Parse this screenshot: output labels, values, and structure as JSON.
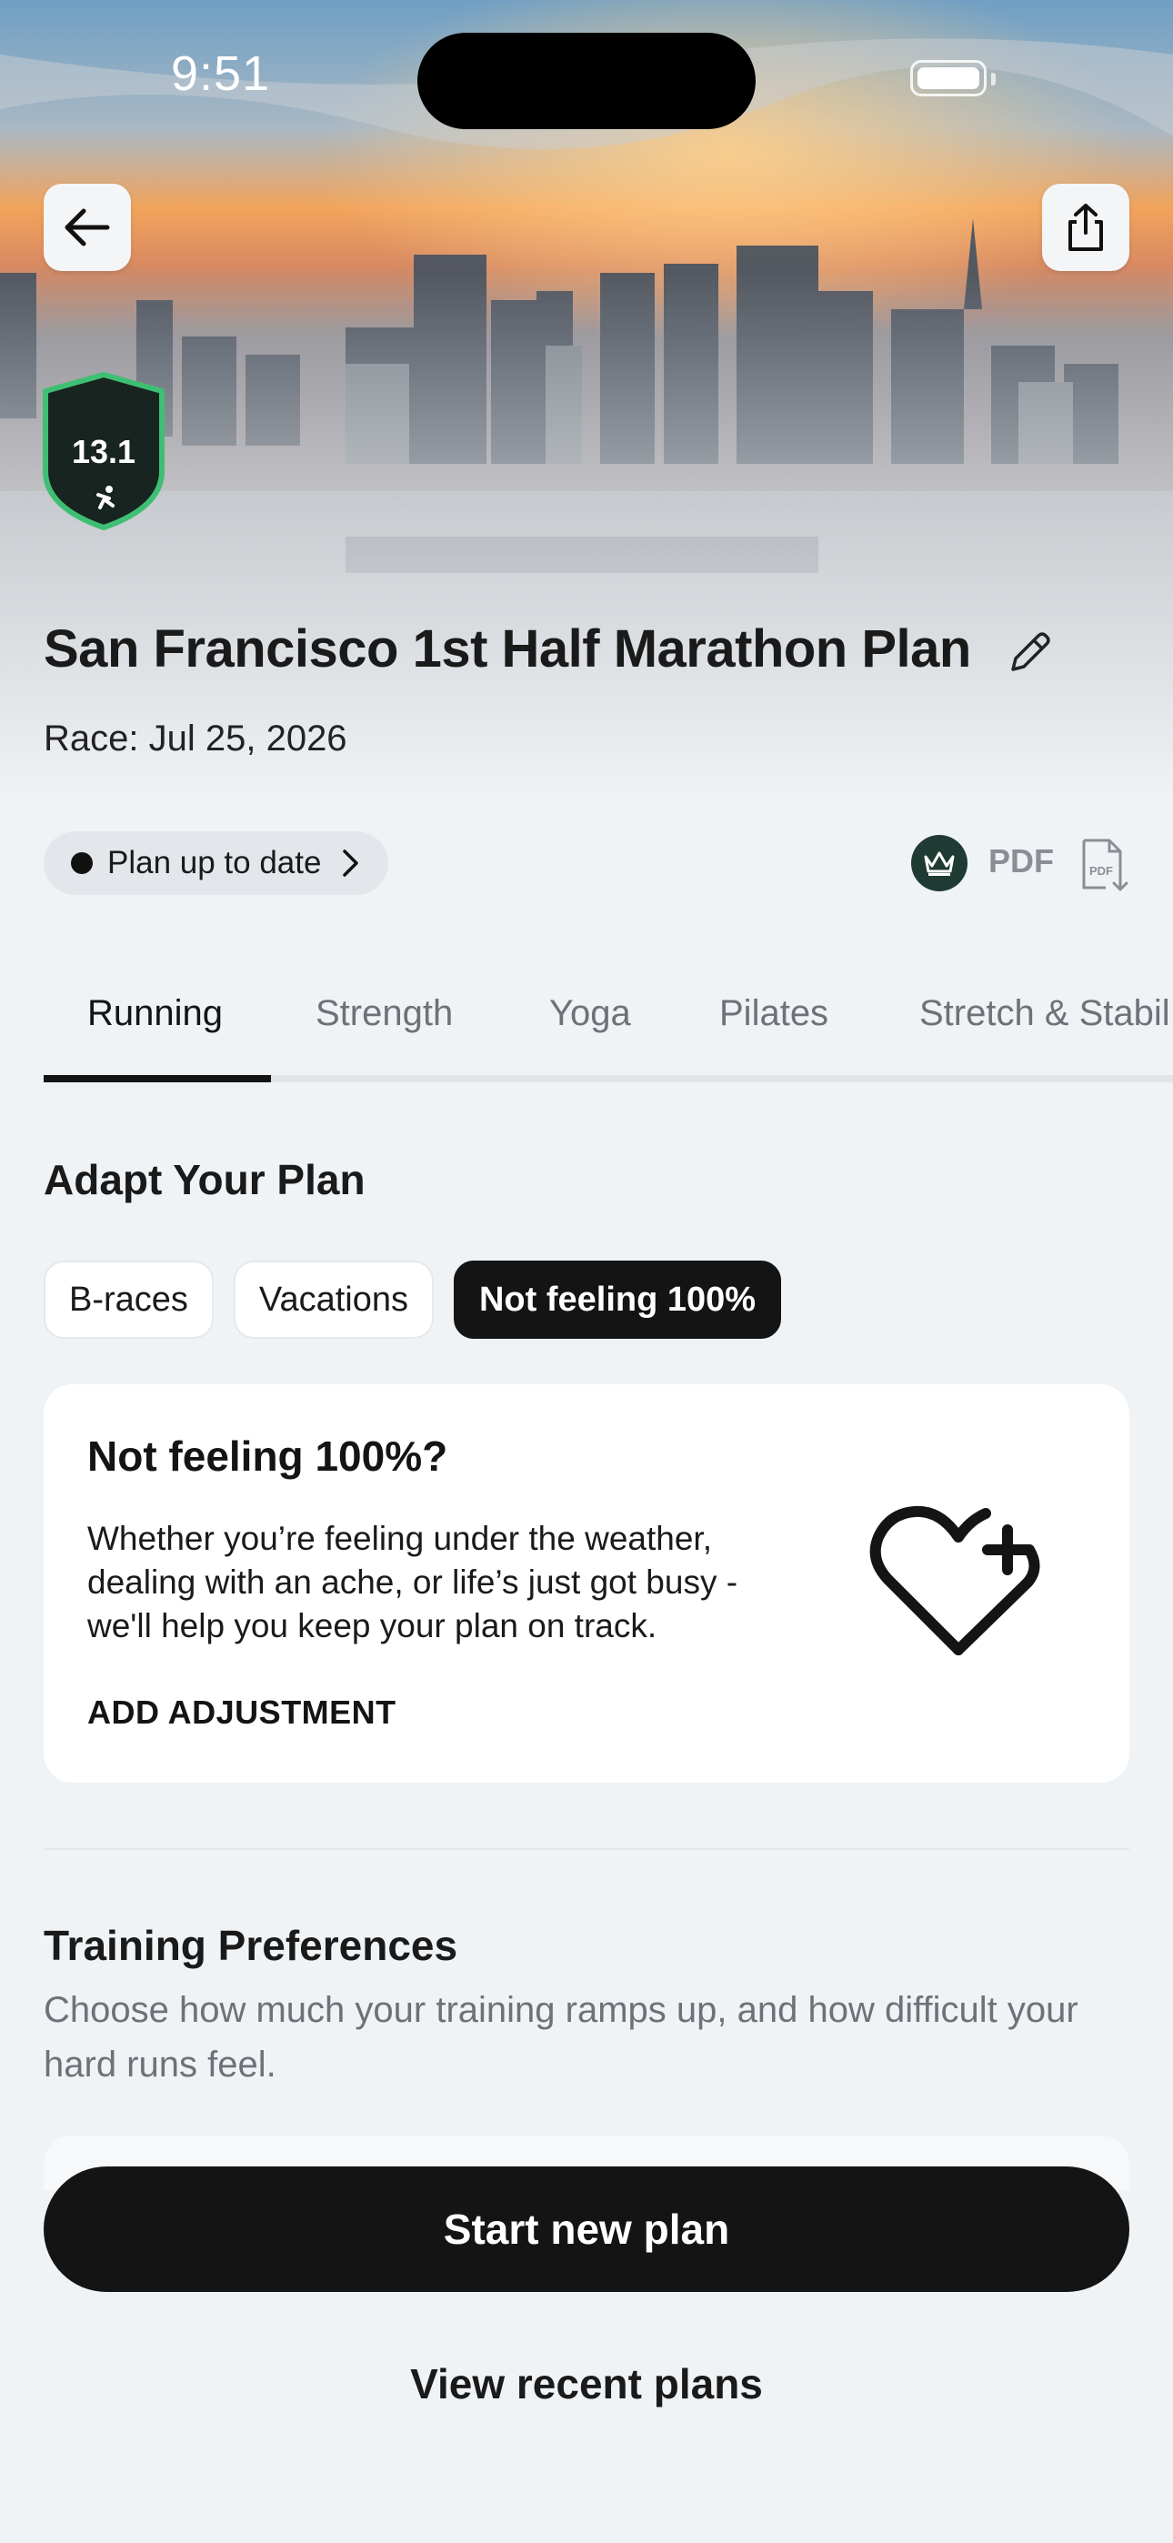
{
  "status_bar": {
    "time": "9:51"
  },
  "hero": {
    "badge_distance": "13.1",
    "plan_title": "San Francisco 1st Half Marathon Plan",
    "race_date": "Race: Jul 25, 2026"
  },
  "plan_status": {
    "label": "Plan up to date",
    "pdf_label": "PDF"
  },
  "tabs": [
    {
      "label": "Running",
      "active": true
    },
    {
      "label": "Strength",
      "active": false
    },
    {
      "label": "Yoga",
      "active": false
    },
    {
      "label": "Pilates",
      "active": false
    },
    {
      "label": "Stretch & Stabil",
      "active": false
    }
  ],
  "adapt": {
    "title": "Adapt Your Plan",
    "chips": [
      {
        "label": "B-races",
        "active": false
      },
      {
        "label": "Vacations",
        "active": false
      },
      {
        "label": "Not feeling 100%",
        "active": true
      }
    ],
    "card": {
      "title": "Not feeling 100%?",
      "body": "Whether you’re feeling under the weather, dealing with an ache, or life’s just got busy - we'll help you keep your plan on track.",
      "action": "ADD ADJUSTMENT"
    }
  },
  "preferences": {
    "title": "Training Preferences",
    "body": "Choose how much your training ramps up, and how difficult your hard runs feel."
  },
  "footer": {
    "primary_label": "Start new plan",
    "secondary_label": "View recent plans"
  },
  "colors": {
    "badge_green": "#3fbf73",
    "badge_fill": "#17241f",
    "primary": "#141414"
  },
  "icons": [
    "back-arrow-icon",
    "share-icon",
    "half-marathon-badge-icon",
    "pencil-icon",
    "chevron-right-icon",
    "crown-icon",
    "pdf-download-icon",
    "heart-plus-icon"
  ]
}
